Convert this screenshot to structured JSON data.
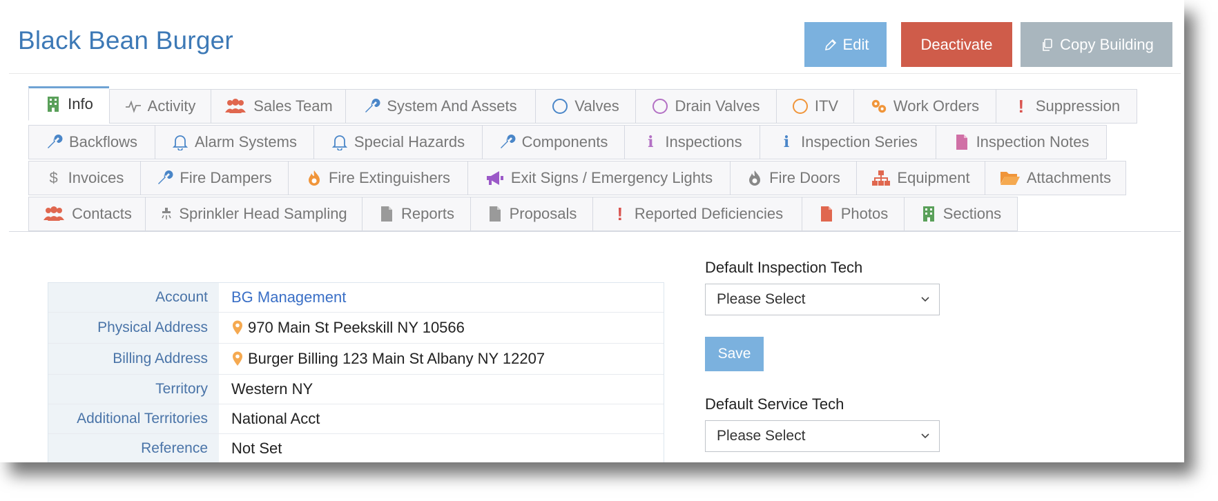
{
  "page": {
    "title": "Black Bean Burger"
  },
  "actions": {
    "edit": "Edit",
    "deactivate": "Deactivate",
    "copy": "Copy Building"
  },
  "tabs": [
    {
      "label": "Info",
      "icon": "building-icon"
    },
    {
      "label": "Activity",
      "icon": "activity-pulse-icon"
    },
    {
      "label": "Sales Team",
      "icon": "users-icon"
    },
    {
      "label": "System And Assets",
      "icon": "wrench-icon"
    },
    {
      "label": "Valves",
      "icon": "circle-icon"
    },
    {
      "label": "Drain Valves",
      "icon": "circle-icon"
    },
    {
      "label": "ITV",
      "icon": "circle-icon"
    },
    {
      "label": "Work Orders",
      "icon": "gears-icon"
    },
    {
      "label": "Suppression",
      "icon": "exclamation-icon"
    },
    {
      "label": "Backflows",
      "icon": "wrench-icon"
    },
    {
      "label": "Alarm Systems",
      "icon": "bell-icon"
    },
    {
      "label": "Special Hazards",
      "icon": "bell-icon"
    },
    {
      "label": "Components",
      "icon": "wrench-icon"
    },
    {
      "label": "Inspections",
      "icon": "info-icon"
    },
    {
      "label": "Inspection Series",
      "icon": "info-icon"
    },
    {
      "label": "Inspection Notes",
      "icon": "file-icon"
    },
    {
      "label": "Invoices",
      "icon": "dollar-icon"
    },
    {
      "label": "Fire Dampers",
      "icon": "wrench-icon"
    },
    {
      "label": "Fire Extinguishers",
      "icon": "fire-icon"
    },
    {
      "label": "Exit Signs / Emergency Lights",
      "icon": "bullhorn-icon"
    },
    {
      "label": "Fire Doors",
      "icon": "fire-icon"
    },
    {
      "label": "Equipment",
      "icon": "sitemap-icon"
    },
    {
      "label": "Attachments",
      "icon": "folder-open-icon"
    },
    {
      "label": "Contacts",
      "icon": "users-icon"
    },
    {
      "label": "Sprinkler Head Sampling",
      "icon": "sprinkler-icon"
    },
    {
      "label": "Reports",
      "icon": "file-icon"
    },
    {
      "label": "Proposals",
      "icon": "file-icon"
    },
    {
      "label": "Reported Deficiencies",
      "icon": "exclamation-icon"
    },
    {
      "label": "Photos",
      "icon": "file-icon"
    },
    {
      "label": "Sections",
      "icon": "building-icon"
    }
  ],
  "info": [
    {
      "label": "Account",
      "value": "BG Management"
    },
    {
      "label": "Physical Address",
      "value": "970 Main St Peekskill NY 10566"
    },
    {
      "label": "Billing Address",
      "value": "Burger Billing 123 Main St Albany NY 12207"
    },
    {
      "label": "Territory",
      "value": "Western NY"
    },
    {
      "label": "Additional Territories",
      "value": "National Acct"
    },
    {
      "label": "Reference",
      "value": "Not Set"
    }
  ],
  "form": {
    "inspection_tech_label": "Default Inspection Tech",
    "inspection_tech_value": "Please Select",
    "save": "Save",
    "service_tech_label": "Default Service Tech",
    "service_tech_value": "Please Select"
  },
  "colors": {
    "title": "#3d79b6",
    "edit": "#7bb1de",
    "deactivate": "#cf5c4a",
    "copy": "#a9b6be",
    "tab_wrench": "#4a86c8",
    "tab_orange": "#f0953a",
    "tab_purple": "#b370c4",
    "tab_green": "#5aa05a",
    "tab_red": "#d9534f",
    "tab_pink": "#d070a6"
  }
}
